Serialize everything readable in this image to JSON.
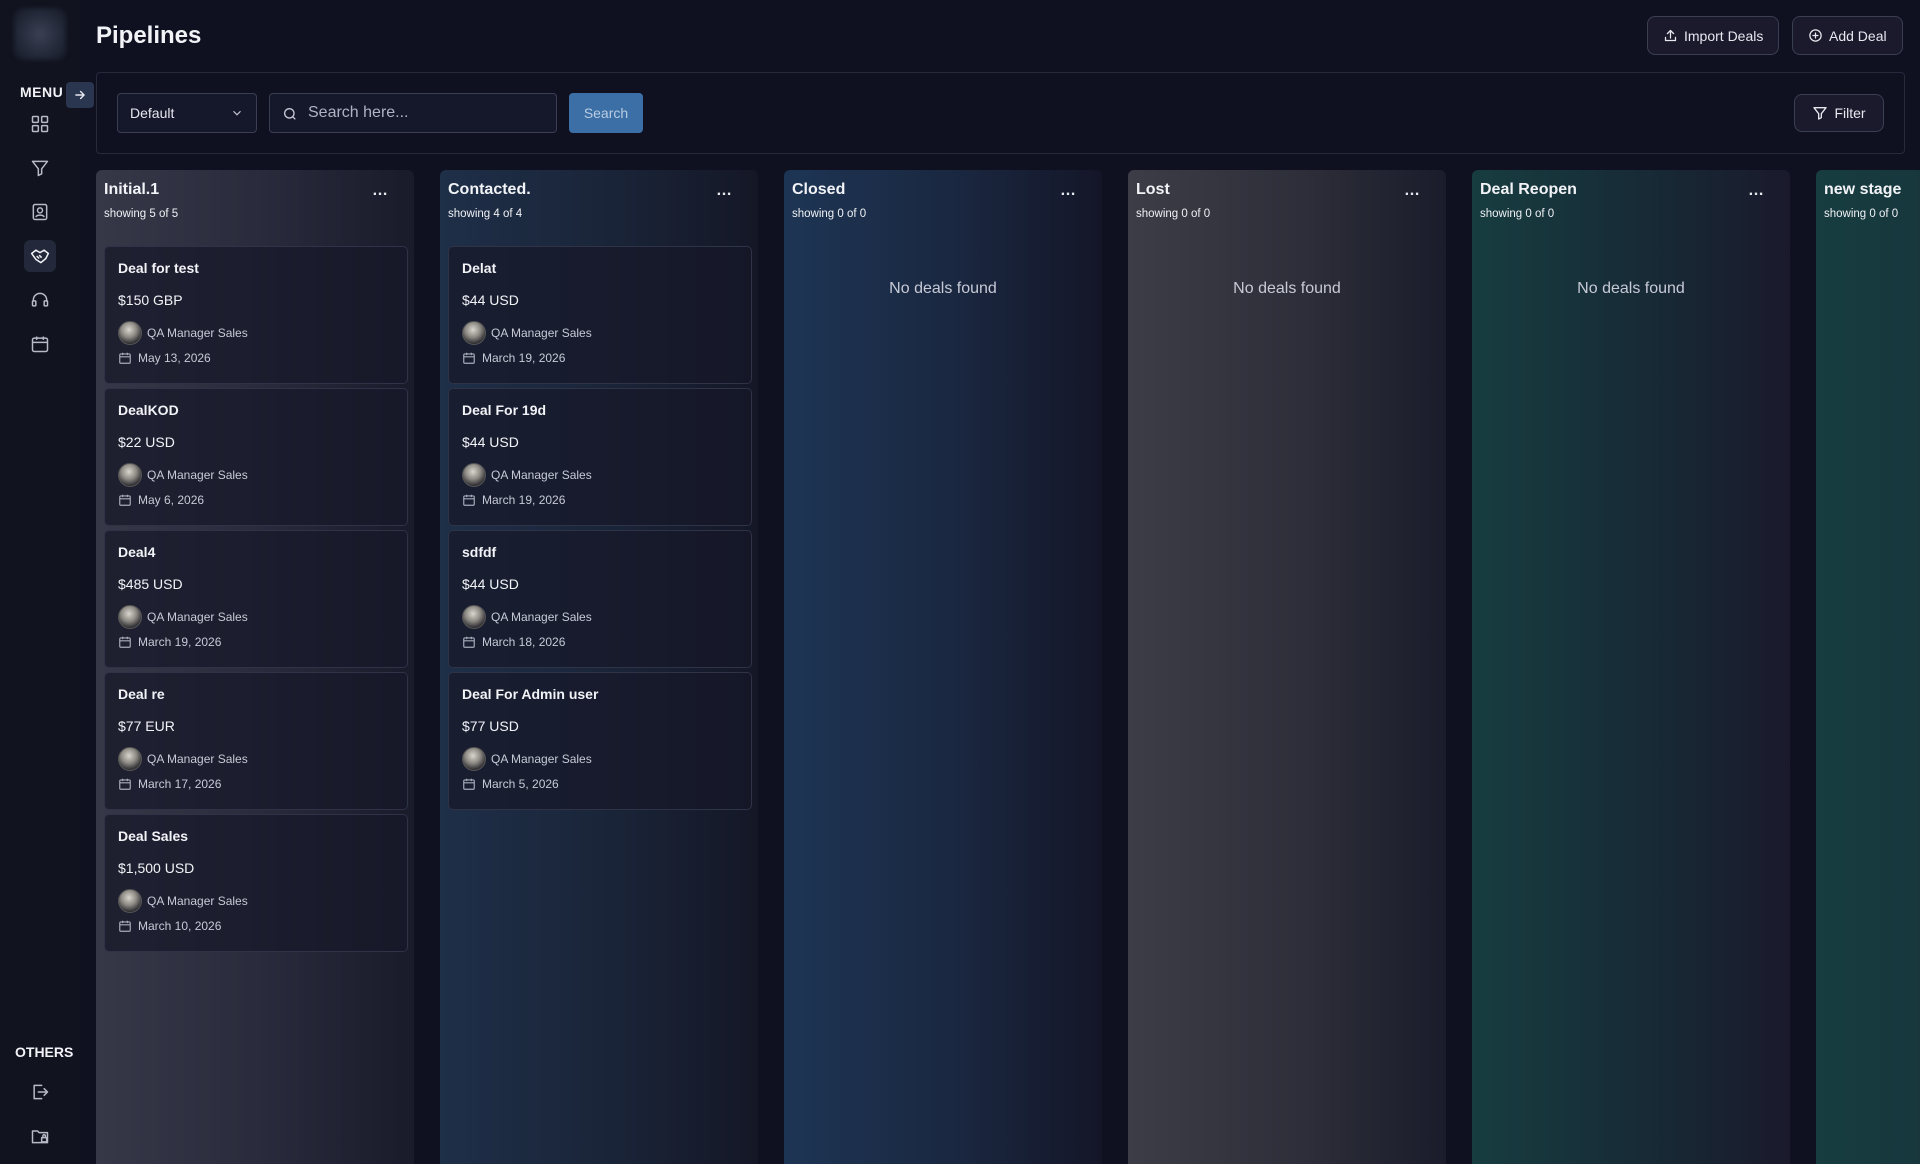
{
  "sidebar": {
    "menu_label": "MENU",
    "others_label": "OTHERS",
    "nav": [
      {
        "icon": "dashboard-grid-icon"
      },
      {
        "icon": "funnel-icon"
      },
      {
        "icon": "contacts-icon"
      },
      {
        "icon": "handshake-icon",
        "active": true
      },
      {
        "icon": "headset-icon"
      },
      {
        "icon": "calendar-icon"
      }
    ],
    "others": [
      {
        "icon": "logout-icon"
      },
      {
        "icon": "folder-lock-icon"
      }
    ]
  },
  "header": {
    "title": "Pipelines",
    "import_label": "Import Deals",
    "add_label": "Add Deal"
  },
  "toolbar": {
    "pipeline_select": "Default",
    "search_placeholder": "Search here...",
    "search_button": "Search",
    "filter_button": "Filter"
  },
  "stages": [
    {
      "name": "Initial.1",
      "summary": "showing 5 of 5",
      "empty_text": "",
      "deals": [
        {
          "title": "Deal for test",
          "amount": "$150 GBP",
          "owner": "QA Manager Sales",
          "date": "May 13, 2026"
        },
        {
          "title": "DealKOD",
          "amount": "$22 USD",
          "owner": "QA Manager Sales",
          "date": "May 6, 2026"
        },
        {
          "title": "Deal4",
          "amount": "$485 USD",
          "owner": "QA Manager Sales",
          "date": "March 19, 2026"
        },
        {
          "title": "Deal re",
          "amount": "$77 EUR",
          "owner": "QA Manager Sales",
          "date": "March 17, 2026"
        },
        {
          "title": "Deal Sales",
          "amount": "$1,500 USD",
          "owner": "QA Manager Sales",
          "date": "March 10, 2026"
        }
      ]
    },
    {
      "name": "Contacted.",
      "summary": "showing 4 of 4",
      "empty_text": "",
      "deals": [
        {
          "title": "Delat",
          "amount": "$44 USD",
          "owner": "QA Manager Sales",
          "date": "March 19, 2026"
        },
        {
          "title": "Deal For 19d",
          "amount": "$44 USD",
          "owner": "QA Manager Sales",
          "date": "March 19, 2026"
        },
        {
          "title": "sdfdf",
          "amount": "$44 USD",
          "owner": "QA Manager Sales",
          "date": "March 18, 2026"
        },
        {
          "title": "Deal For Admin user",
          "amount": "$77 USD",
          "owner": "QA Manager Sales",
          "date": "March 5, 2026"
        }
      ]
    },
    {
      "name": "Closed",
      "summary": "showing 0 of 0",
      "empty_text": "No deals found",
      "deals": []
    },
    {
      "name": "Lost",
      "summary": "showing 0 of 0",
      "empty_text": "No deals found",
      "deals": []
    },
    {
      "name": "Deal Reopen",
      "summary": "showing 0 of 0",
      "empty_text": "No deals found",
      "deals": []
    },
    {
      "name": "new stage",
      "summary": "showing 0 of 0",
      "empty_text": "",
      "deals": []
    }
  ],
  "colors": {
    "initial_stage": "#2a2c3e",
    "contacted_stage": "#1e3048",
    "closed_stage": "#1d3655",
    "lost_stage": "#3a3b44",
    "reopen_stage": "#173b3e",
    "new_stage": "#173b3e",
    "search_button": "#3b6fa5"
  }
}
